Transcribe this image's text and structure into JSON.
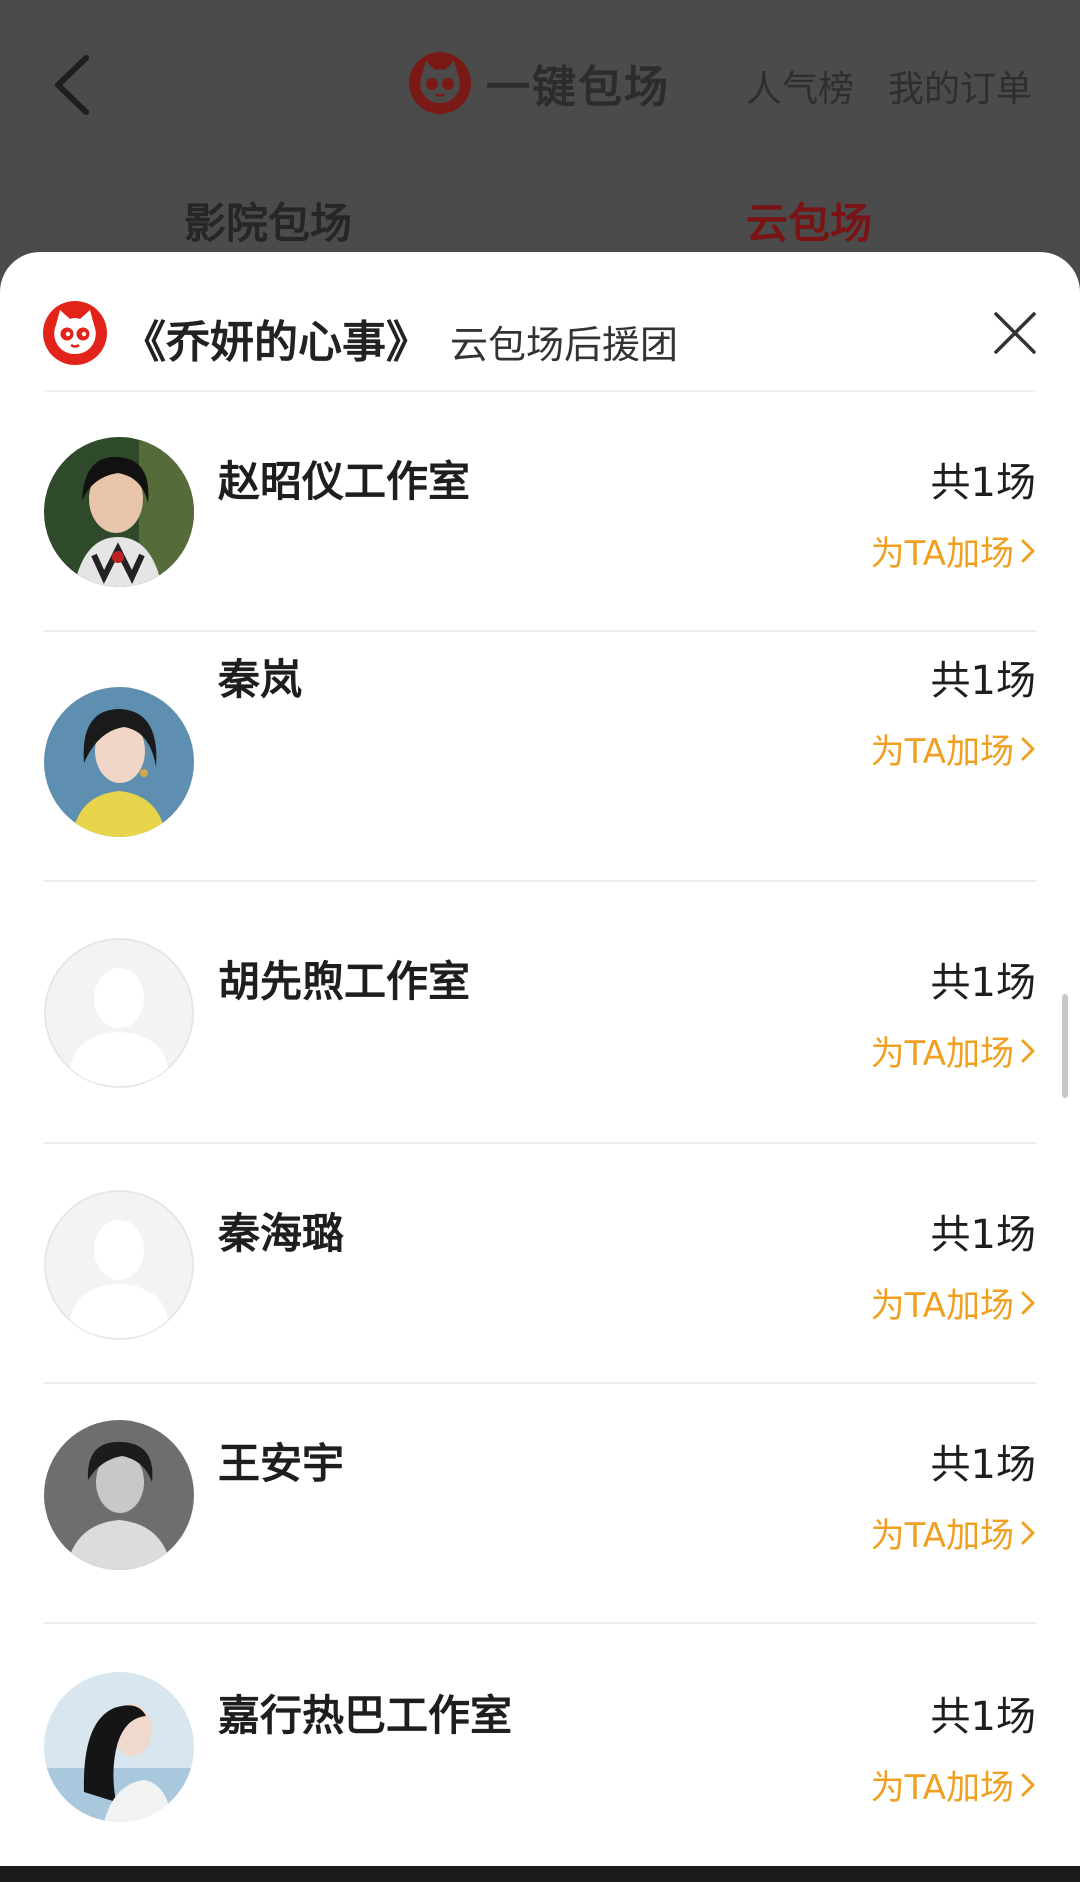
{
  "header": {
    "brand_title": "一键包场",
    "rank_link": "人气榜",
    "orders_link": "我的订单",
    "tabs": [
      {
        "label": "影院包场",
        "active": false
      },
      {
        "label": "云包场",
        "active": true
      }
    ]
  },
  "sheet": {
    "title": "《乔妍的心事》",
    "subtitle": "云包场后援团",
    "rows": [
      {
        "name": "赵昭仪工作室",
        "count": "共1场",
        "action": "为TA加场",
        "avatar": "photo"
      },
      {
        "name": "秦岚",
        "count": "共1场",
        "action": "为TA加场",
        "avatar": "photo"
      },
      {
        "name": "胡先煦工作室",
        "count": "共1场",
        "action": "为TA加场",
        "avatar": "placeholder"
      },
      {
        "name": "秦海璐",
        "count": "共1场",
        "action": "为TA加场",
        "avatar": "placeholder"
      },
      {
        "name": "王安宇",
        "count": "共1场",
        "action": "为TA加场",
        "avatar": "photo"
      },
      {
        "name": "嘉行热巴工作室",
        "count": "共1场",
        "action": "为TA加场",
        "avatar": "photo"
      }
    ]
  },
  "colors": {
    "accent_orange": "#f0a020",
    "brand_red": "#e2231a",
    "active_tab": "#7a1414",
    "overlay": "#4b4b4b"
  },
  "icons": [
    "back-arrow-icon",
    "cat-logo-icon",
    "close-icon",
    "chevron-right-icon",
    "default-avatar-icon"
  ]
}
